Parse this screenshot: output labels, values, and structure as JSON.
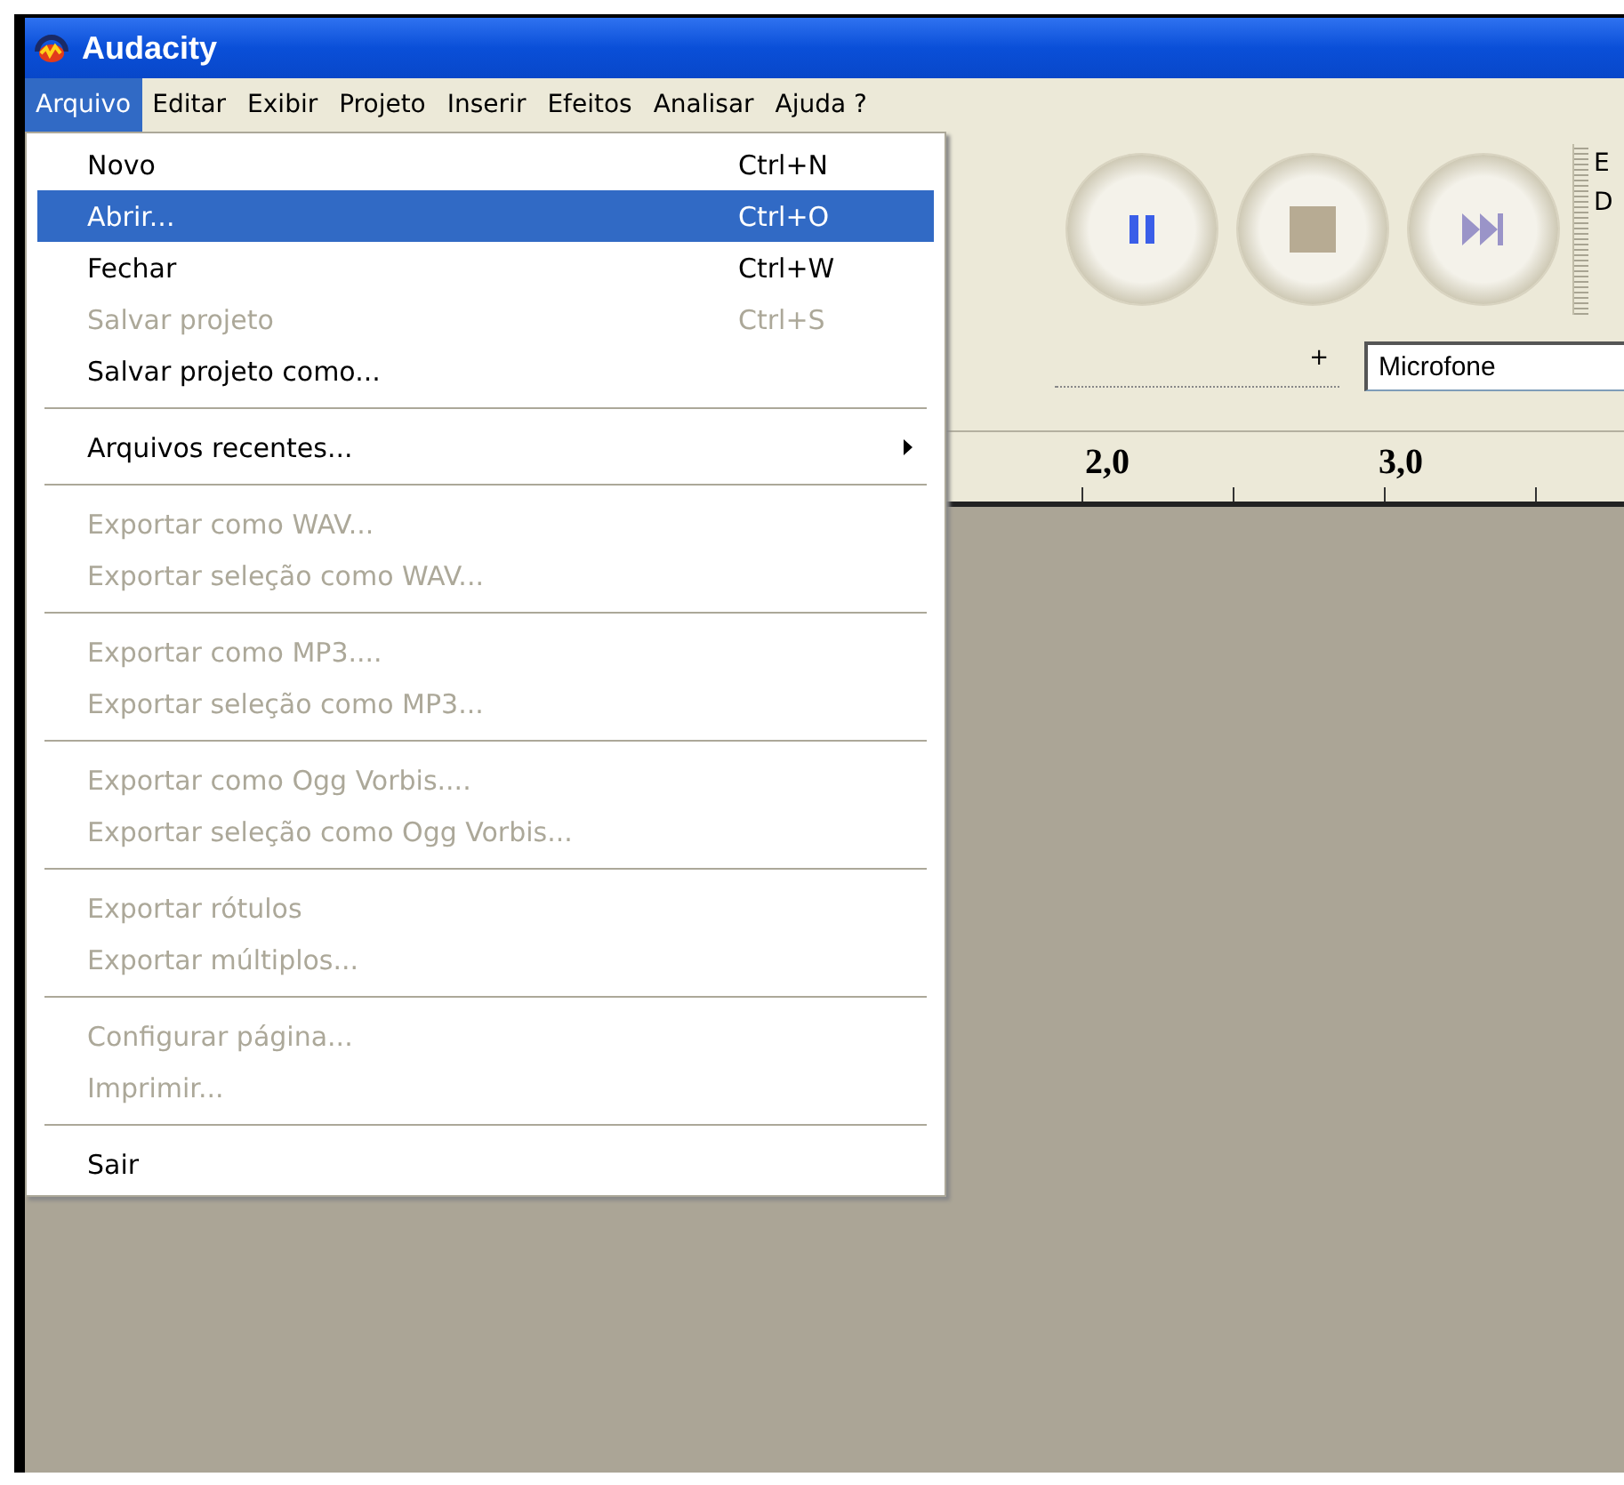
{
  "window": {
    "title": "Audacity"
  },
  "menubar": [
    {
      "label": "Arquivo",
      "selected": true
    },
    {
      "label": "Editar",
      "selected": false
    },
    {
      "label": "Exibir",
      "selected": false
    },
    {
      "label": "Projeto",
      "selected": false
    },
    {
      "label": "Inserir",
      "selected": false
    },
    {
      "label": "Efeitos",
      "selected": false
    },
    {
      "label": "Analisar",
      "selected": false
    },
    {
      "label": "Ajuda ?",
      "selected": false
    }
  ],
  "menu": [
    {
      "kind": "item",
      "label": "Novo",
      "shortcut": "Ctrl+N",
      "disabled": false,
      "selected": false
    },
    {
      "kind": "item",
      "label": "Abrir...",
      "shortcut": "Ctrl+O",
      "disabled": false,
      "selected": true
    },
    {
      "kind": "item",
      "label": "Fechar",
      "shortcut": "Ctrl+W",
      "disabled": false,
      "selected": false
    },
    {
      "kind": "item",
      "label": "Salvar projeto",
      "shortcut": "Ctrl+S",
      "disabled": true,
      "selected": false
    },
    {
      "kind": "item",
      "label": "Salvar projeto como...",
      "disabled": false,
      "selected": false
    },
    {
      "kind": "separator"
    },
    {
      "kind": "submenu",
      "label": "Arquivos recentes...",
      "disabled": false,
      "selected": false
    },
    {
      "kind": "separator"
    },
    {
      "kind": "item",
      "label": "Exportar como WAV...",
      "disabled": true,
      "selected": false
    },
    {
      "kind": "item",
      "label": "Exportar seleção como WAV...",
      "disabled": true,
      "selected": false
    },
    {
      "kind": "separator"
    },
    {
      "kind": "item",
      "label": "Exportar como MP3....",
      "disabled": true,
      "selected": false
    },
    {
      "kind": "item",
      "label": "Exportar seleção como MP3...",
      "disabled": true,
      "selected": false
    },
    {
      "kind": "separator"
    },
    {
      "kind": "item",
      "label": "Exportar como Ogg Vorbis....",
      "disabled": true,
      "selected": false
    },
    {
      "kind": "item",
      "label": "Exportar seleção como Ogg Vorbis...",
      "disabled": true,
      "selected": false
    },
    {
      "kind": "separator"
    },
    {
      "kind": "item",
      "label": "Exportar rótulos",
      "disabled": true,
      "selected": false
    },
    {
      "kind": "item",
      "label": "Exportar múltiplos...",
      "disabled": true,
      "selected": false
    },
    {
      "kind": "separator"
    },
    {
      "kind": "item",
      "label": "Configurar página...",
      "disabled": true,
      "selected": false
    },
    {
      "kind": "item",
      "label": "Imprimir...",
      "disabled": true,
      "selected": false
    },
    {
      "kind": "separator"
    },
    {
      "kind": "item",
      "label": "Sair",
      "disabled": false,
      "selected": false
    }
  ],
  "toolbar": {
    "buttons": [
      {
        "kind": "pause"
      },
      {
        "kind": "stop"
      },
      {
        "kind": "skip"
      }
    ],
    "meter_labels": [
      "E",
      "D"
    ],
    "slider_plus": "+",
    "input_device": "Microfone"
  },
  "ruler": {
    "labels": [
      "2,0",
      "3,0"
    ]
  }
}
